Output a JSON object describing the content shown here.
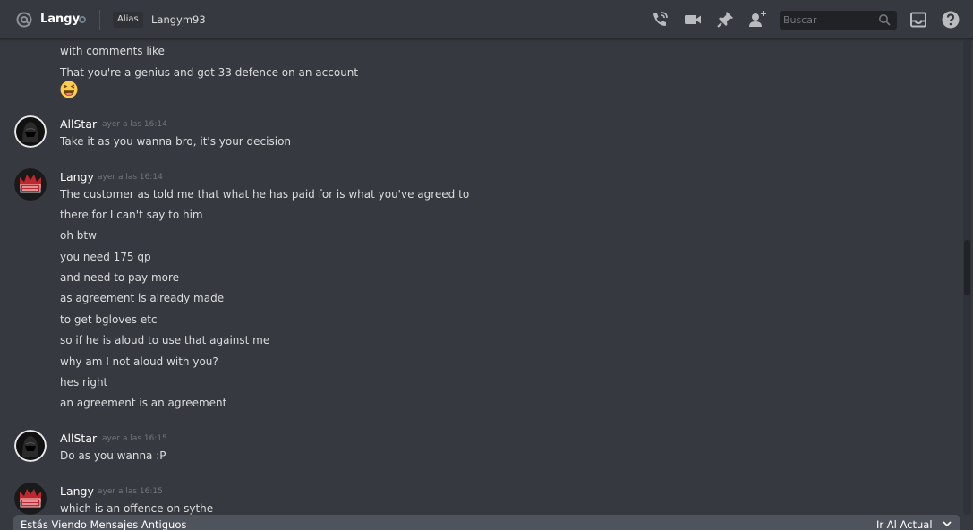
{
  "header": {
    "channel_name": "Langy",
    "alias_label": "Alias",
    "alias_value": "Langym93",
    "search_placeholder": "Buscar"
  },
  "messages": [
    {
      "type": "continuation",
      "lines": [
        "with comments like",
        "That you're a genius and got 33 defence on an account"
      ],
      "emoji": "laughing"
    },
    {
      "type": "group",
      "author": "AllStar",
      "timestamp": "ayer a las 16:14",
      "lines": [
        "Take it as you wanna bro, it's your decision"
      ]
    },
    {
      "type": "group",
      "author": "Langy",
      "timestamp": "ayer a las 16:14",
      "lines": [
        "The customer as told me that what he has paid for is what you've agreed to",
        "there for I can't say to him",
        "oh btw",
        "you need 175 qp",
        "and need to pay more",
        "as agreement is already made",
        "to get bgloves etc",
        "so if he is aloud to use that against me",
        "why am I not aloud with you?",
        "hes right",
        "an agreement is an agreement"
      ]
    },
    {
      "type": "group",
      "author": "AllStar",
      "timestamp": "ayer a las 16:15",
      "lines": [
        "Do as you wanna :P"
      ]
    },
    {
      "type": "group",
      "author": "Langy",
      "timestamp": "ayer a las 16:15",
      "lines": [
        "which is an offence on sythe"
      ]
    }
  ],
  "footer": {
    "old_messages_label": "Estás Viendo Mensajes Antiguos",
    "jump_label": "Ir Al Actual"
  },
  "icons": [
    "at-icon",
    "call-icon",
    "video-icon",
    "pin-icon",
    "add-friend-icon",
    "search-icon",
    "inbox-icon",
    "help-icon",
    "chevron-down-icon"
  ],
  "colors": {
    "background": "#36393f",
    "header_border": "#26282c",
    "search_bg": "#202225",
    "muted": "#72767d",
    "old_bar": "#4f545c"
  }
}
